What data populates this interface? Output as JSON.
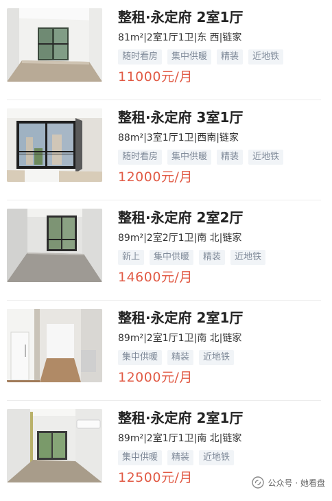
{
  "listings": [
    {
      "title": "整租·永定府 2室1厅",
      "meta": "81m²|2室1厅1卫|东 西|链家",
      "tags": [
        "随时看房",
        "集中供暖",
        "精装",
        "近地铁"
      ],
      "price": "11000元/月",
      "photo": "empty-room-window"
    },
    {
      "title": "整租·永定府 3室1厅",
      "meta": "88m²|3室1厅1卫|西南|链家",
      "tags": [
        "随时看房",
        "集中供暖",
        "精装",
        "近地铁"
      ],
      "price": "12000元/月",
      "photo": "corner-window-room"
    },
    {
      "title": "整租·永定府 2室2厅",
      "meta": "89m²|2室2厅1卫|南 北|链家",
      "tags": [
        "新上",
        "集中供暖",
        "精装",
        "近地铁"
      ],
      "price": "14600元/月",
      "photo": "living-room-window"
    },
    {
      "title": "整租·永定府 2室1厅",
      "meta": "89m²|2室1厅1卫|南 北|链家",
      "tags": [
        "集中供暖",
        "精装",
        "近地铁"
      ],
      "price": "12000元/月",
      "photo": "hallway-fridge"
    },
    {
      "title": "整租·永定府 2室1厅",
      "meta": "89m²|2室1厅1卫|南 北|链家",
      "tags": [
        "集中供暖",
        "精装",
        "近地铁"
      ],
      "price": "12500元/月",
      "photo": "room-with-ac"
    }
  ],
  "watermark": {
    "text": "公众号 · 她看盘",
    "icon": "wechat-official-account-icon"
  },
  "colors": {
    "price": "#e15a45",
    "tag_bg": "#f1f4f7",
    "tag_text": "#7f8a99",
    "title": "#222222"
  }
}
